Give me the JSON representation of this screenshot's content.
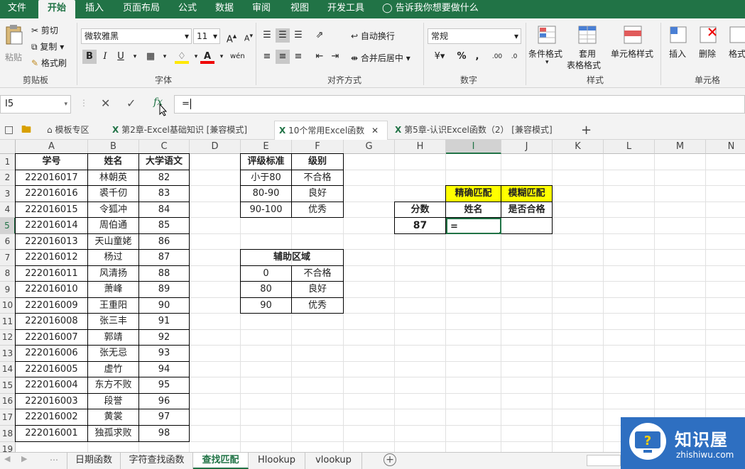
{
  "ribbon_tabs": [
    "文件",
    "开始",
    "插入",
    "页面布局",
    "公式",
    "数据",
    "审阅",
    "视图",
    "开发工具"
  ],
  "tell_me": "告诉我你想要做什么",
  "clipboard": {
    "paste": "粘贴",
    "cut": "剪切",
    "copy": "复制",
    "format_painter": "格式刷",
    "label": "剪贴板"
  },
  "font": {
    "name": "微软雅黑",
    "size": "11",
    "bold": "B",
    "italic": "I",
    "underline": "U",
    "label": "字体"
  },
  "alignment": {
    "wrap": "自动换行",
    "merge": "合并后居中",
    "label": "对齐方式"
  },
  "number": {
    "format": "常规",
    "percent": "%",
    "comma": ",",
    "label": "数字"
  },
  "styles": {
    "conditional": "条件格式",
    "table_format_1": "套用",
    "table_format_2": "表格格式",
    "cell_styles": "单元格样式",
    "label": "样式"
  },
  "cells": {
    "insert": "插入",
    "delete": "删除",
    "format": "格式",
    "label": "单元格"
  },
  "formula_bar": {
    "name_box": "I5",
    "content": "="
  },
  "doc_tabs": [
    "模板专区",
    "第2章-Excel基础知识  [兼容模式]",
    "10个常用Excel函数",
    "第5章-认识Excel函数（2）  [兼容模式]"
  ],
  "columns": [
    "A",
    "B",
    "C",
    "D",
    "E",
    "F",
    "G",
    "H",
    "I",
    "J",
    "K",
    "L",
    "M",
    "N"
  ],
  "rows": [
    "1",
    "2",
    "3",
    "4",
    "5",
    "6",
    "7",
    "8",
    "9",
    "10",
    "11",
    "12",
    "13",
    "14",
    "15",
    "16",
    "17",
    "18",
    "19"
  ],
  "main_table": {
    "headers": [
      "学号",
      "姓名",
      "大学语文"
    ],
    "rows": [
      [
        "222016017",
        "林朝英",
        "82"
      ],
      [
        "222016016",
        "裘千仞",
        "83"
      ],
      [
        "222016015",
        "令狐冲",
        "84"
      ],
      [
        "222016014",
        "周伯通",
        "85"
      ],
      [
        "222016013",
        "天山童姥",
        "86"
      ],
      [
        "222016012",
        "杨过",
        "87"
      ],
      [
        "222016011",
        "风清扬",
        "88"
      ],
      [
        "222016010",
        "萧峰",
        "89"
      ],
      [
        "222016009",
        "王重阳",
        "90"
      ],
      [
        "222016008",
        "张三丰",
        "91"
      ],
      [
        "222016007",
        "郭靖",
        "92"
      ],
      [
        "222016006",
        "张无忌",
        "93"
      ],
      [
        "222016005",
        "虚竹",
        "94"
      ],
      [
        "222016004",
        "东方不败",
        "95"
      ],
      [
        "222016003",
        "段誉",
        "96"
      ],
      [
        "222016002",
        "黄裳",
        "97"
      ],
      [
        "222016001",
        "独孤求败",
        "98"
      ]
    ]
  },
  "grade_table": {
    "headers": [
      "评级标准",
      "级别"
    ],
    "rows": [
      [
        "小于80",
        "不合格"
      ],
      [
        "80-90",
        "良好"
      ],
      [
        "90-100",
        "优秀"
      ]
    ]
  },
  "helper_table": {
    "title": "辅助区域",
    "rows": [
      [
        "0",
        "不合格"
      ],
      [
        "80",
        "良好"
      ],
      [
        "90",
        "优秀"
      ]
    ]
  },
  "lookup": {
    "exact": "精确匹配",
    "fuzzy": "模糊匹配",
    "score_label": "分数",
    "name_label": "姓名",
    "pass_label": "是否合格",
    "score_value": "87",
    "name_value": "=",
    "pass_value": ""
  },
  "sheet_tabs": [
    "日期函数",
    "字符查找函数",
    "查找匹配",
    "Hlookup",
    "vlookup"
  ],
  "watermark": {
    "brand": "知识屋",
    "url": "zhishiwu.com"
  },
  "colors": {
    "accent": "#217346",
    "yellow": "#ffff00",
    "watermark": "#2e6fc1"
  }
}
